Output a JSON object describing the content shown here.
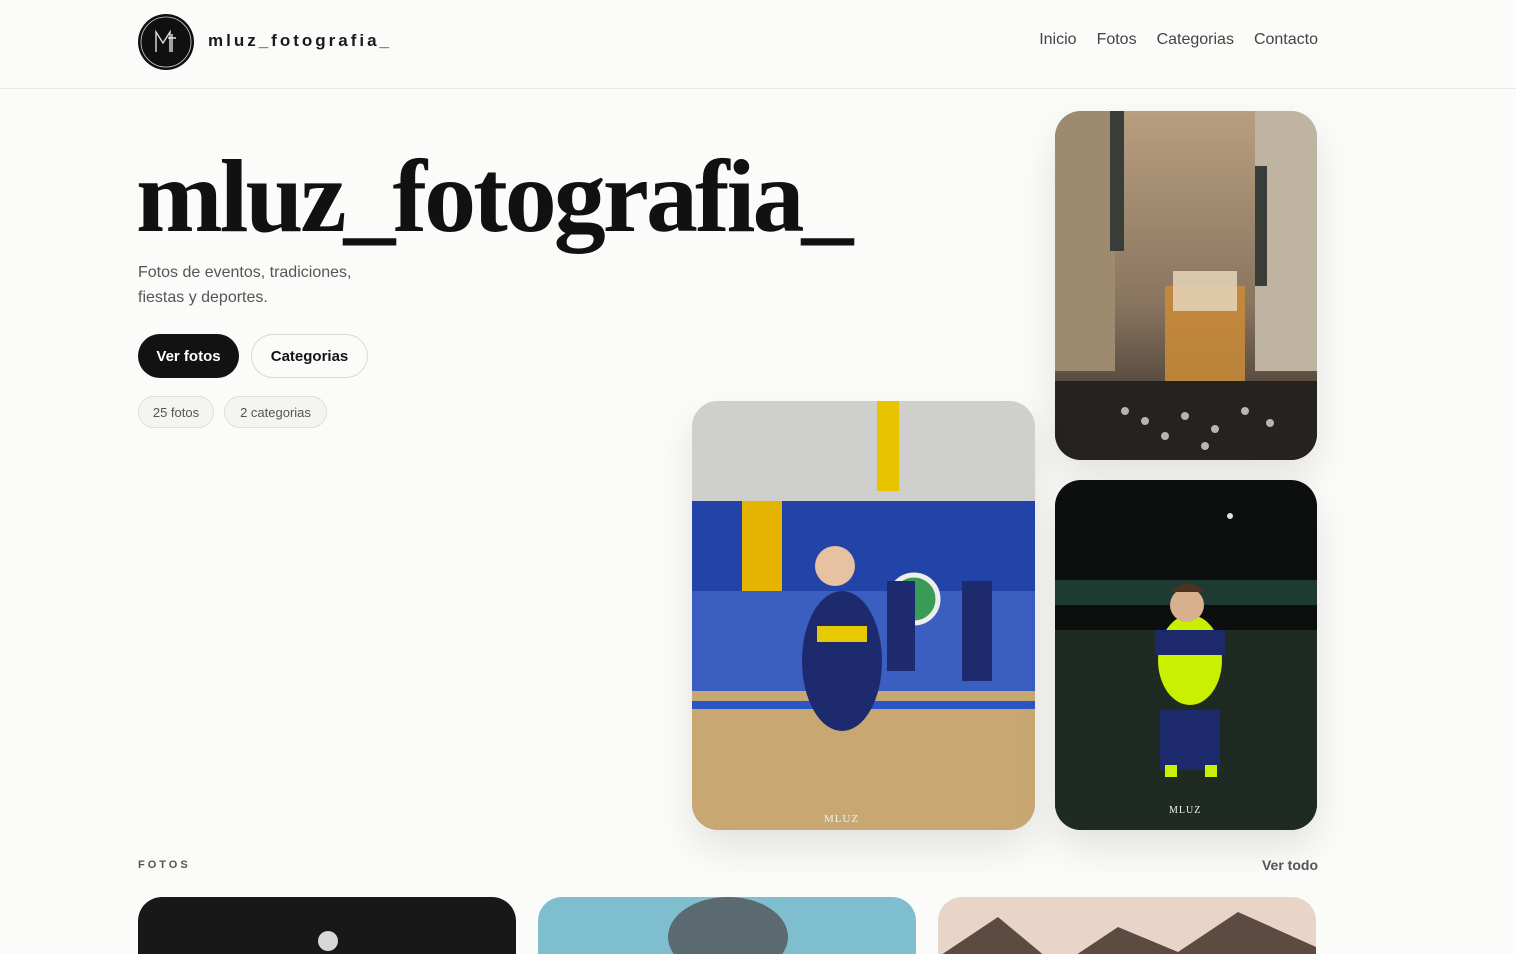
{
  "header": {
    "brand": "mluz_fotografia_",
    "nav": [
      "Inicio",
      "Fotos",
      "Categorias",
      "Contacto"
    ]
  },
  "hero": {
    "title": "mluz_fotografia_",
    "subtitle": "Fotos de eventos, tradiciones, fiestas y deportes.",
    "primary_button": "Ver fotos",
    "secondary_button": "Categorias",
    "stats": [
      "25 fotos",
      "2 categorias"
    ]
  },
  "photos_section": {
    "label": "FOTOS",
    "view_all": "Ver todo"
  },
  "watermark": "MLUZ",
  "colors": {
    "background": "#fbfbf9",
    "primary": "#121212",
    "jersey_yellow": "#c8f000",
    "jersey_navy": "#1c2a6b"
  }
}
